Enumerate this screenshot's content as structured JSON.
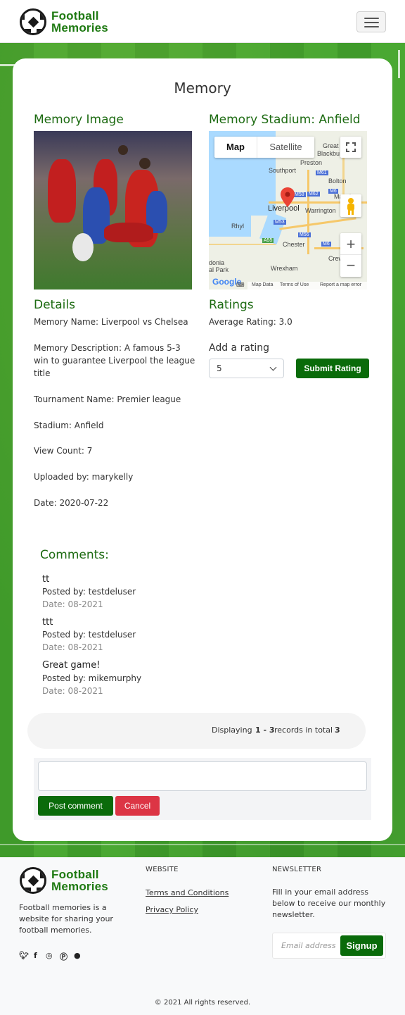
{
  "brand": {
    "name_line1": "Football",
    "name_line2": "Memories"
  },
  "page": {
    "title": "Memory"
  },
  "memory_image": {
    "heading": "Memory Image"
  },
  "stadium_map": {
    "heading": "Memory Stadium: Anfield",
    "tab_map": "Map",
    "tab_satellite": "Satellite",
    "zoom_in": "+",
    "zoom_out": "−",
    "places": [
      "Great Ec",
      "Blackbu",
      "Preston",
      "Southport",
      "Bolton",
      "Manche",
      "Liverpool",
      "Warrington",
      "Rhyl",
      "Chester",
      "Crewe",
      "Wrexham",
      "donia",
      "al Park"
    ],
    "road_labels": [
      "M61",
      "M6",
      "M58",
      "M62",
      "M53",
      "M56",
      "A55",
      "M6"
    ],
    "footer_data": "Map Data",
    "footer_terms": "Terms of Use",
    "footer_report": "Report a map error",
    "google": "Google"
  },
  "details": {
    "heading": "Details",
    "name": "Memory Name: Liverpool vs Chelsea",
    "description_line1": "Memory Description: A famous 5-3",
    "description_line2": "win to guarantee Liverpool the league",
    "description_line3": "title",
    "tournament": "Tournament Name: Premier league",
    "stadium": "Stadium: Anfield",
    "views": "View Count: 7",
    "uploader": "Uploaded by: marykelly",
    "date": "Date: 2020-07-22"
  },
  "ratings": {
    "heading": "Ratings",
    "average": "Average Rating: 3.0",
    "add_label": "Add a rating",
    "selected": "5",
    "submit": "Submit Rating"
  },
  "comments": {
    "heading": "Comments:",
    "items": [
      {
        "text": "tt",
        "by": "Posted by: testdeluser",
        "date": "Date: 08-2021"
      },
      {
        "text": "ttt",
        "by": "Posted by: testdeluser",
        "date": "Date: 08-2021"
      },
      {
        "text": "Great game!",
        "by": "Posted by: mikemurphy",
        "date": "Date: 08-2021"
      }
    ]
  },
  "pagination": {
    "prefix": "Displaying",
    "range": "1 - 3",
    "middle": "records in total",
    "total": "3"
  },
  "comment_form": {
    "post": "Post comment",
    "cancel": "Cancel"
  },
  "footer": {
    "about_line1": "Football memories is a",
    "about_line2": "website for sharing your",
    "about_line3": "football memories.",
    "website_heading": "WEBSITE",
    "terms": "Terms and Conditions",
    "privacy": "Privacy Policy",
    "newsletter_heading": "NEWSLETTER",
    "newsletter_line1": "Fill in your email address",
    "newsletter_line2": "below to receive our monthly",
    "newsletter_line3": "newsletter.",
    "email_placeholder": "Email address",
    "signup": "Signup",
    "copyright": "© 2021 All rights reserved."
  },
  "social_icons": [
    "twitter-icon",
    "facebook-icon",
    "instagram-icon",
    "pinterest-icon",
    "snapchat-icon"
  ],
  "colors": {
    "brand_green": "#1f7a13",
    "button_green": "#0a6b0a",
    "danger": "#dc3545"
  }
}
